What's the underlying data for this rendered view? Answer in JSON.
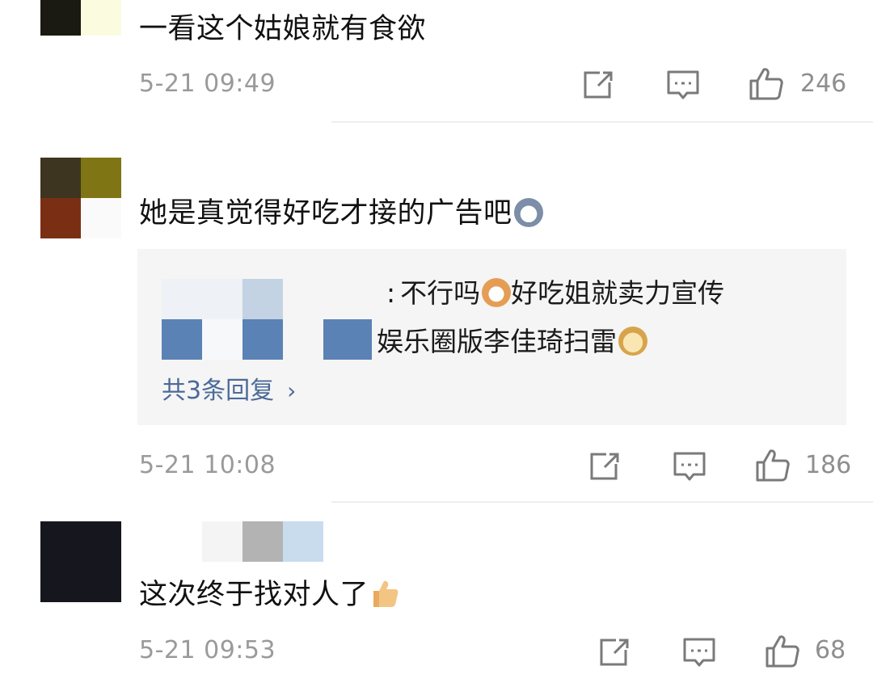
{
  "comments": [
    {
      "text": "一看这个姑娘就有食欲",
      "time": "5-21 09:49",
      "likes": "246",
      "icons": [
        "share-icon",
        "comment-icon",
        "like-icon"
      ]
    },
    {
      "text": "她是真觉得好吃才接的广告吧",
      "time": "5-21 10:08",
      "likes": "186",
      "replies": [
        {
          "separator": ":",
          "text": "不行吗",
          "after_emoji": "好吃姐就卖力宣传"
        },
        {
          "text": "娱乐圈版李佳琦扫雷"
        }
      ],
      "more_replies": "共3条回复",
      "icons": [
        "share-icon",
        "comment-icon",
        "like-icon"
      ]
    },
    {
      "text": "这次终于找对人了",
      "time": "5-21 09:53",
      "likes": "68",
      "icons": [
        "share-icon",
        "comment-icon",
        "like-icon"
      ]
    }
  ],
  "colors": {
    "time": "#9a9a9a",
    "link": "#4b6a99",
    "reply_bg": "#f5f5f5",
    "divider": "#efefef"
  }
}
